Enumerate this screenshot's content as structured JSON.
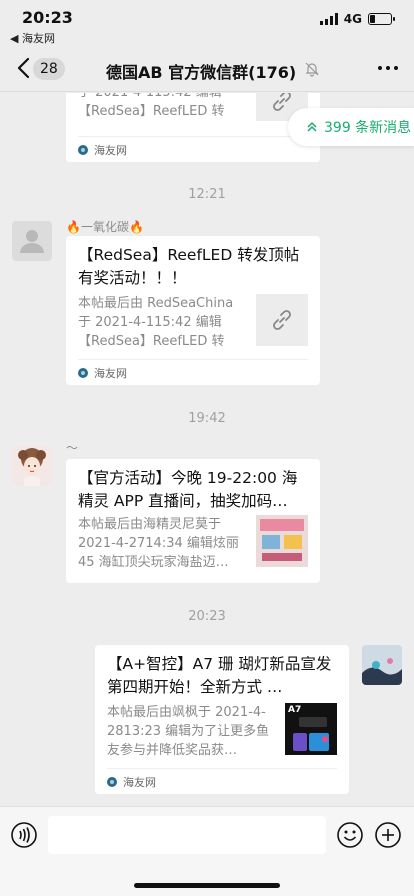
{
  "status_bar": {
    "time": "20:23",
    "back_app": "◀ 海友网",
    "network": "4G",
    "battery_level": 0.25
  },
  "nav": {
    "back_count": "28",
    "title": "德国AB  官方微信群(176)"
  },
  "new_messages": {
    "label": "399 条新消息"
  },
  "messages": [
    {
      "desc": "于 2021-4-115:42 编辑【RedSea】ReefLED 转发…",
      "source": "海友网"
    },
    {
      "time": "12:21"
    },
    {
      "sender": "🔥一氧化碳🔥",
      "title": "【RedSea】ReefLED 转发顶帖有奖活动！！！",
      "desc": "本帖最后由 RedSeaChina 于 2021-4-115:42 编辑【RedSea】ReefLED 转发…",
      "source": "海友网"
    },
    {
      "time": "19:42"
    },
    {
      "sender": "〜",
      "title": "【官方活动】今晚 19-22:00 海精灵 APP 直播间，抽奖加码…",
      "desc": "本帖最后由海精灵尼莫于 2021-4-2714:34 编辑炫丽 45 海缸顶尖玩家海盐迈…",
      "source": ""
    },
    {
      "time": "20:23"
    },
    {
      "title": "【A+智控】A7 珊 瑚灯新品宣发  第四期开始！全新方式 …",
      "desc": "本帖最后由飒枫于 2021-4-2813:23 编辑为了让更多鱼友参与并降低奖品获…",
      "source": "海友网",
      "thumb_text": "A7"
    }
  ]
}
